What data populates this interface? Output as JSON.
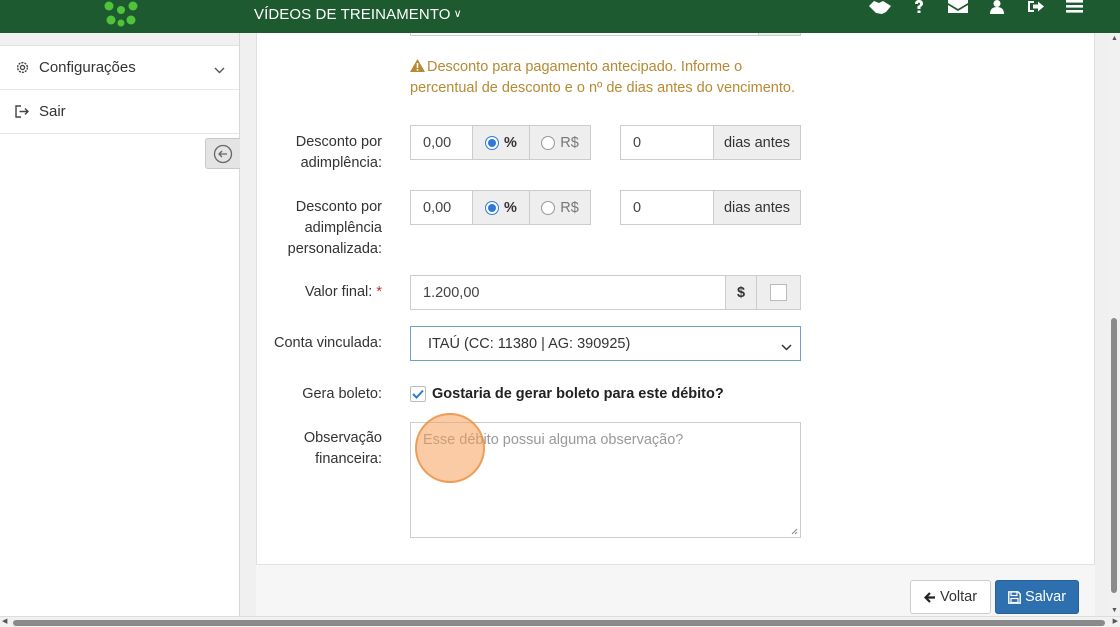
{
  "topbar": {
    "menu_title": "VÍDEOS DE TREINAMENTO",
    "icons": [
      "handshake-icon",
      "help-icon",
      "envelope-icon",
      "user-icon",
      "logout-icon",
      "hamburger-icon"
    ],
    "brand_color": "#1e5a2f"
  },
  "sidebar": {
    "items": [
      {
        "label": "Configurações",
        "icon": "gear-icon"
      },
      {
        "label": "Sair",
        "icon": "sign-out-icon"
      }
    ]
  },
  "form": {
    "warning": "Desconto para pagamento antecipado. Informe o percentual de desconto e o nº de dias antes do vencimento.",
    "desconto_adimplencia": {
      "label": "Desconto por adimplência:",
      "value": "0,00",
      "opt_percent": "%",
      "opt_currency": "R$",
      "selected": "%",
      "days": "0",
      "days_addon": "dias antes"
    },
    "desconto_personalizada": {
      "label": "Desconto por adimplência personalizada:",
      "value": "0,00",
      "opt_percent": "%",
      "opt_currency": "R$",
      "selected": "%",
      "days": "0",
      "days_addon": "dias antes"
    },
    "valor_final": {
      "label": "Valor final:",
      "required_mark": "*",
      "value": "1.200,00",
      "addon": "$"
    },
    "conta_vinculada": {
      "label": "Conta vinculada:",
      "selected": "ITAÚ (CC: 11380 | AG: 390925)"
    },
    "gera_boleto": {
      "label": "Gera boleto:",
      "checked": true,
      "checkbox_label": "Gostaria de gerar boleto para este débito?"
    },
    "observacao": {
      "label": "Observação financeira:",
      "placeholder": "Esse débito possui alguma observação?"
    }
  },
  "footer": {
    "back_label": "Voltar",
    "save_label": "Salvar",
    "save_color": "#2e6fb0"
  },
  "colors": {
    "warning": "#b58a33",
    "radio_selected": "#2f7ad8"
  }
}
